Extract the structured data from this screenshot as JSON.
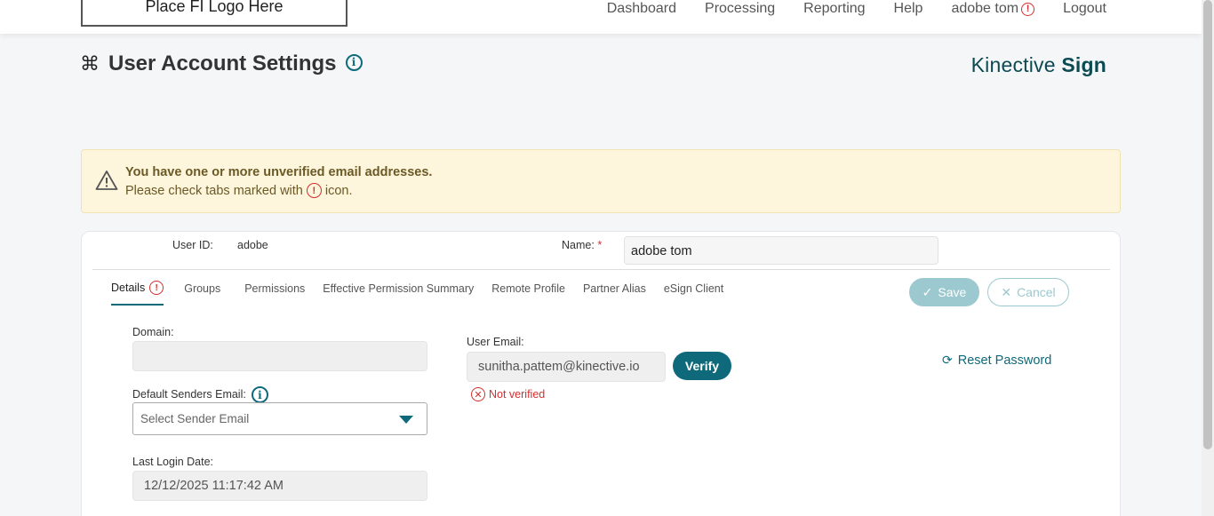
{
  "nav": {
    "logo_text": "Place FI Logo Here",
    "links": [
      "Dashboard",
      "Processing",
      "Reporting",
      "Help",
      "adobe tom",
      "Logout"
    ],
    "alert_glyph": "!"
  },
  "header": {
    "title": "User Account Settings",
    "info_glyph": "i",
    "brand_light": "Kinective",
    "brand_bold": "Sign"
  },
  "alert": {
    "title": "You have one or more unverified email addresses.",
    "text_before": "Please check tabs marked with",
    "glyph": "!",
    "text_after": "icon."
  },
  "user": {
    "id_label": "User ID:",
    "id_value": "adobe",
    "name_label": "Name:",
    "required_mark": "*",
    "name_value": "adobe tom"
  },
  "tabs": [
    {
      "label": "Details",
      "alert": "!"
    },
    {
      "label": "Groups"
    },
    {
      "label": "Permissions"
    },
    {
      "label": "Effective Permission Summary"
    },
    {
      "label": "Remote Profile"
    },
    {
      "label": "Partner Alias"
    },
    {
      "label": "eSign Client"
    }
  ],
  "actions": {
    "save_label": "Save",
    "cancel_label": "Cancel"
  },
  "details": {
    "domain_label": "Domain:",
    "domain_value": "",
    "default_sender_label": "Default Senders Email:",
    "default_sender_placeholder": "Select Sender Email",
    "last_login_label": "Last Login Date:",
    "last_login_value": "12/12/2025 11:17:42 AM",
    "user_email_label": "User Email:",
    "user_email_value": "sunitha.pattem@kinective.io",
    "verify_label": "Verify",
    "not_verified_label": "Not verified",
    "reset_password_label": "Reset Password"
  },
  "colors": {
    "accent": "#0e6a7a",
    "error": "#d32f2f",
    "alert_bg": "#fdf5dc",
    "alert_text": "#6b5a26"
  }
}
